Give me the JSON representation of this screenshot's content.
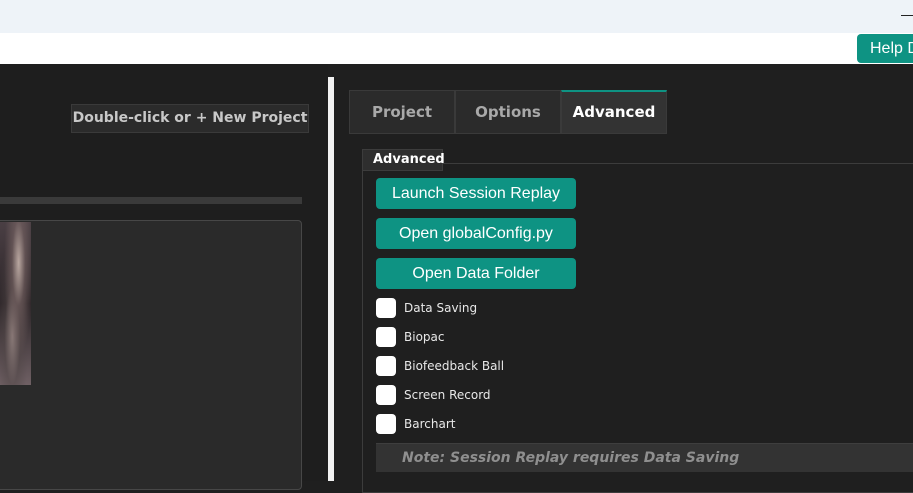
{
  "window": {
    "help_label": "Help Docs"
  },
  "left": {
    "new_project_label": "Double-click or + New Project"
  },
  "tabs": [
    {
      "label": "Project",
      "active": false
    },
    {
      "label": "Options",
      "active": false
    },
    {
      "label": "Advanced",
      "active": true
    }
  ],
  "advanced": {
    "group_title": "Advanced",
    "buttons": [
      {
        "label": "Launch Session Replay"
      },
      {
        "label": "Open globalConfig.py"
      },
      {
        "label": "Open Data Folder"
      }
    ],
    "checkboxes": [
      {
        "label": "Data Saving",
        "checked": false
      },
      {
        "label": "Biopac",
        "checked": false
      },
      {
        "label": "Biofeedback Ball",
        "checked": false
      },
      {
        "label": "Screen Record",
        "checked": false
      },
      {
        "label": "Barchart",
        "checked": false
      }
    ],
    "note": "Note: Session Replay requires Data Saving"
  },
  "colors": {
    "accent": "#0e9383",
    "background": "#1f1f1f",
    "panel": "#2b2b2b"
  }
}
